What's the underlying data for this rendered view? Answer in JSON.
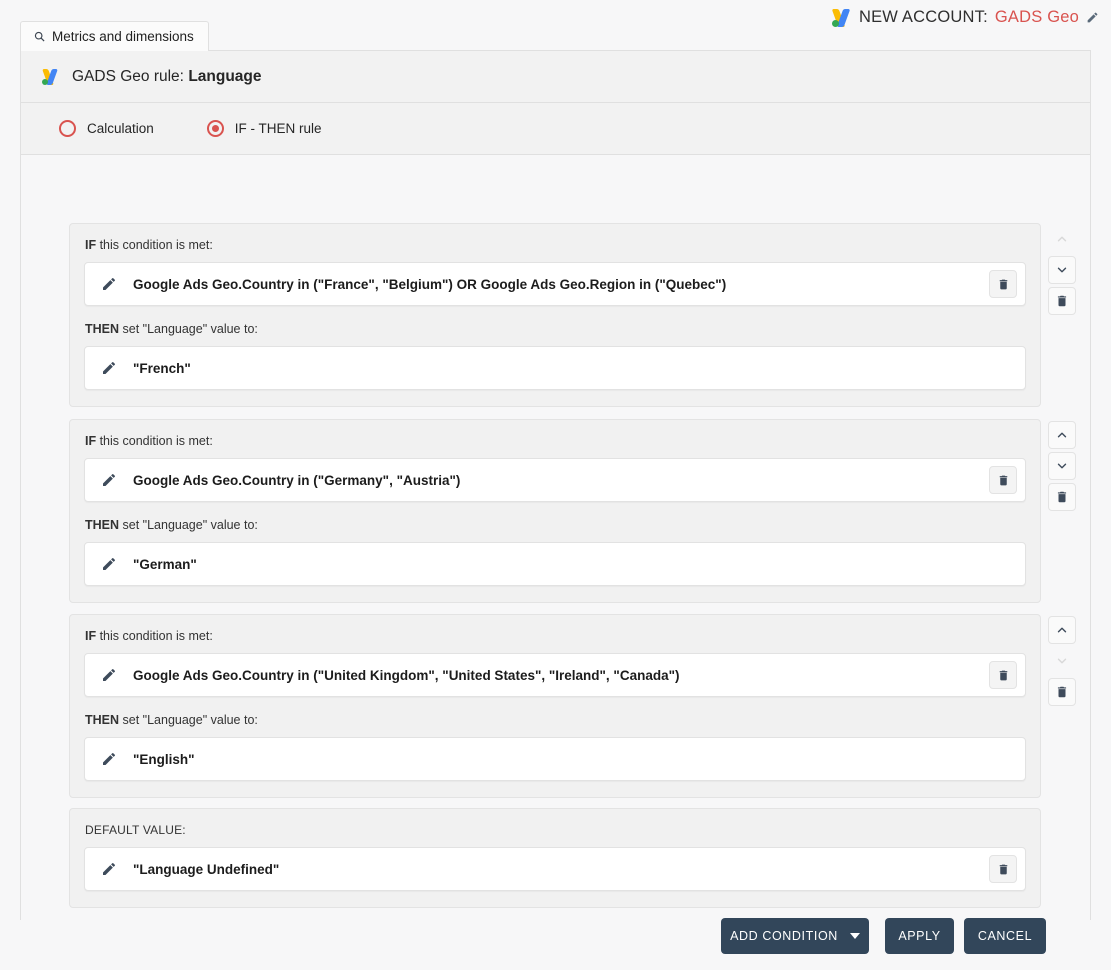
{
  "topbar": {
    "logo_icon": "google-ads-logo",
    "account_prefix": "NEW ACCOUNT:",
    "account_name": "GADS Geo",
    "edit_icon": "pencil-icon"
  },
  "tab": {
    "icon": "search-icon",
    "label": "Metrics and dimensions"
  },
  "card_header": {
    "logo_icon": "google-ads-logo",
    "prefix": "GADS Geo rule:",
    "rule_name": "Language"
  },
  "mode_selector": {
    "options": [
      {
        "label": "Calculation",
        "checked": false
      },
      {
        "label": "IF - THEN rule",
        "checked": true
      }
    ],
    "accent_color": "#d9534f"
  },
  "labels": {
    "if_label": "IF",
    "if_rest": " this condition is met:",
    "then_label": "THEN",
    "then_rest": " set \"Language\" value to:",
    "default_value_label": "DEFAULT VALUE:"
  },
  "blocks": [
    {
      "condition": "Google Ads Geo.Country in (\"France\", \"Belgium\") OR Google Ads Geo.Region in (\"Quebec\")",
      "value": "\"French\"",
      "move_up_enabled": false,
      "move_down_enabled": true
    },
    {
      "condition": "Google Ads Geo.Country in (\"Germany\", \"Austria\")",
      "value": "\"German\"",
      "move_up_enabled": true,
      "move_down_enabled": true
    },
    {
      "condition": "Google Ads Geo.Country in (\"United Kingdom\", \"United States\", \"Ireland\", \"Canada\")",
      "value": "\"English\"",
      "move_up_enabled": true,
      "move_down_enabled": false
    }
  ],
  "default_block": {
    "value": "\"Language Undefined\""
  },
  "footer": {
    "add_condition_label": "ADD CONDITION",
    "apply_label": "APPLY",
    "cancel_label": "CANCEL",
    "button_color": "#32465a"
  },
  "icons": {
    "pencil": "pencil-icon",
    "trash": "trash-icon",
    "chevron_up": "chevron-up-icon",
    "chevron_down": "chevron-down-icon",
    "caret_down": "caret-down-icon"
  }
}
